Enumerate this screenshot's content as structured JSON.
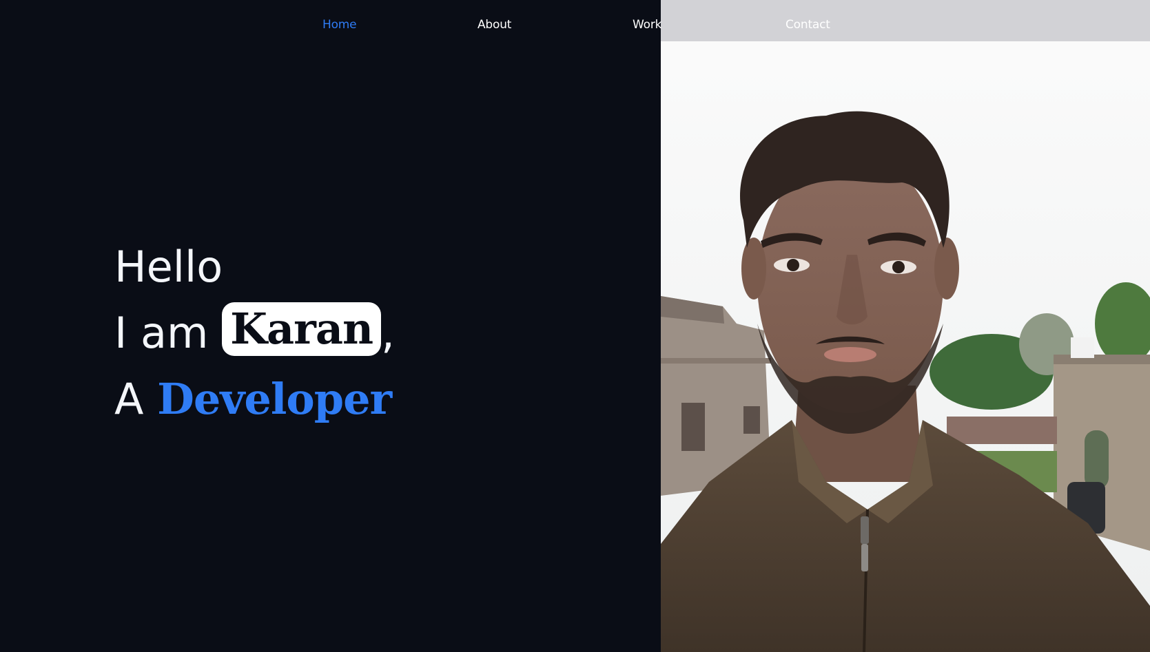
{
  "nav": {
    "items": [
      {
        "label": "Home",
        "active": true
      },
      {
        "label": "About",
        "active": false
      },
      {
        "label": "Work",
        "active": false
      },
      {
        "label": "Contact",
        "active": false
      }
    ]
  },
  "hero": {
    "greeting": "Hello",
    "intro_prefix": "I am",
    "name": "Karan",
    "intro_suffix": ",",
    "role_prefix": "A",
    "role": "Developer"
  },
  "colors": {
    "background": "#0a0d16",
    "accent": "#2f7cf5",
    "text": "#ffffff",
    "nav_overlay": "#d2d2d6"
  },
  "icons": {
    "portrait": "portrait-photo"
  }
}
